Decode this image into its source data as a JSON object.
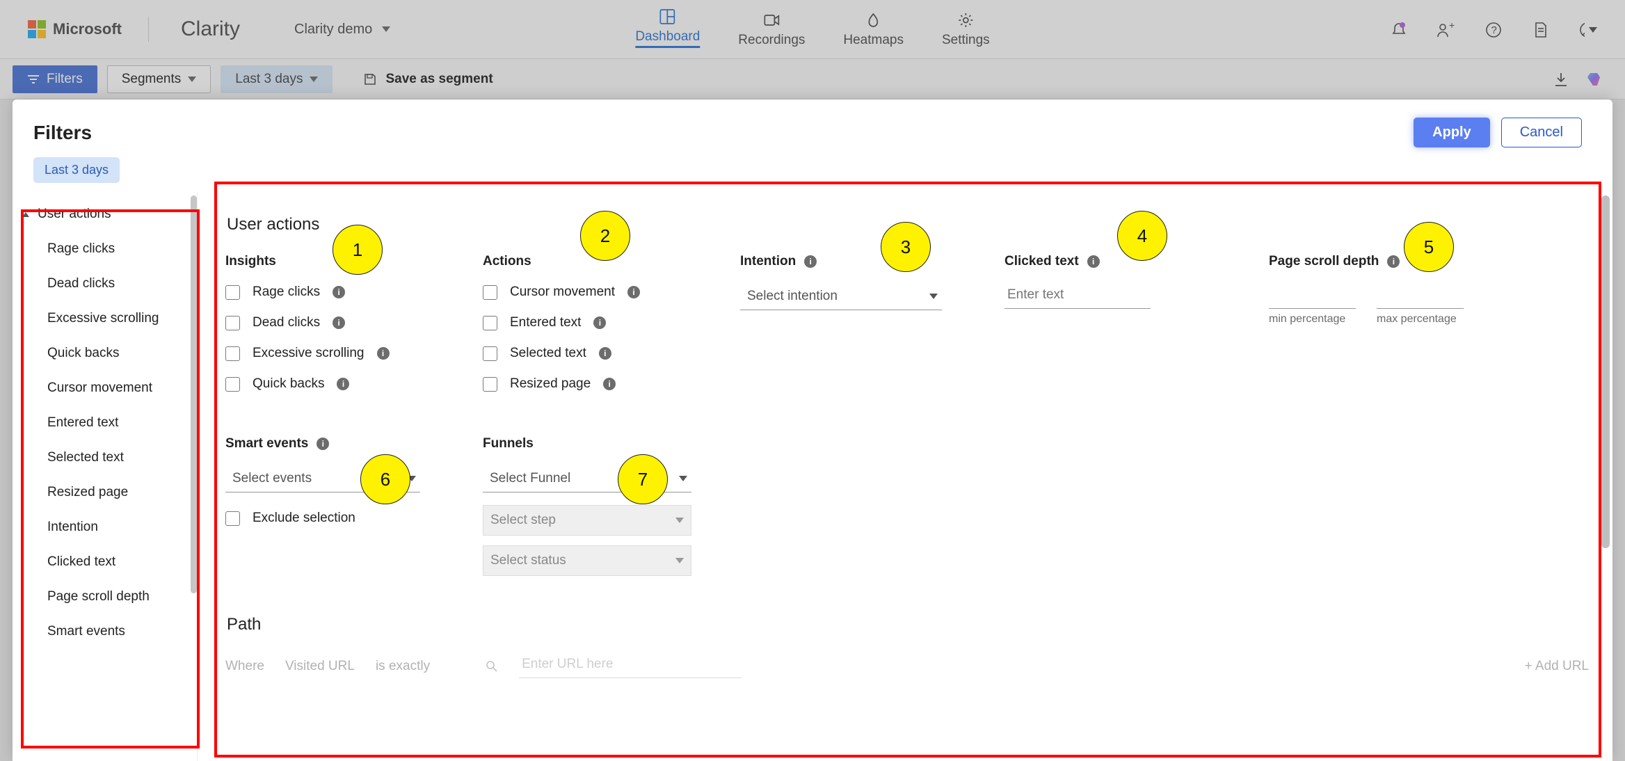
{
  "header": {
    "brand_ms": "Microsoft",
    "brand_app": "Clarity",
    "project": "Clarity demo",
    "nav": {
      "dashboard": "Dashboard",
      "recordings": "Recordings",
      "heatmaps": "Heatmaps",
      "settings": "Settings"
    }
  },
  "subheader": {
    "filters": "Filters",
    "segments": "Segments",
    "daterange": "Last 3 days",
    "save_segment": "Save as segment"
  },
  "modal": {
    "title": "Filters",
    "apply": "Apply",
    "cancel": "Cancel",
    "chip": "Last 3 days"
  },
  "sidebar": {
    "group": "User actions",
    "items": [
      "Rage clicks",
      "Dead clicks",
      "Excessive scrolling",
      "Quick backs",
      "Cursor movement",
      "Entered text",
      "Selected text",
      "Resized page",
      "Intention",
      "Clicked text",
      "Page scroll depth",
      "Smart events"
    ]
  },
  "content": {
    "section1_title": "User actions",
    "insights": {
      "title": "Insights",
      "items": [
        "Rage clicks",
        "Dead clicks",
        "Excessive scrolling",
        "Quick backs"
      ]
    },
    "actions": {
      "title": "Actions",
      "items": [
        "Cursor movement",
        "Entered text",
        "Selected text",
        "Resized page"
      ]
    },
    "intention": {
      "title": "Intention",
      "placeholder": "Select intention"
    },
    "clicked_text": {
      "title": "Clicked text",
      "placeholder": "Enter text"
    },
    "scroll_depth": {
      "title": "Page scroll depth",
      "min_label": "min percentage",
      "max_label": "max percentage"
    },
    "smart_events": {
      "title": "Smart events",
      "select_placeholder": "Select events",
      "exclude": "Exclude selection"
    },
    "funnels": {
      "title": "Funnels",
      "select_funnel": "Select Funnel",
      "select_step": "Select step",
      "select_status": "Select status"
    },
    "section2_title": "Path",
    "path_row": {
      "where": "Where",
      "field": "Visited URL",
      "op": "is exactly",
      "input_placeholder": "Enter URL here",
      "add": "+ Add URL"
    }
  },
  "annotations": [
    "1",
    "2",
    "3",
    "4",
    "5",
    "6",
    "7"
  ]
}
